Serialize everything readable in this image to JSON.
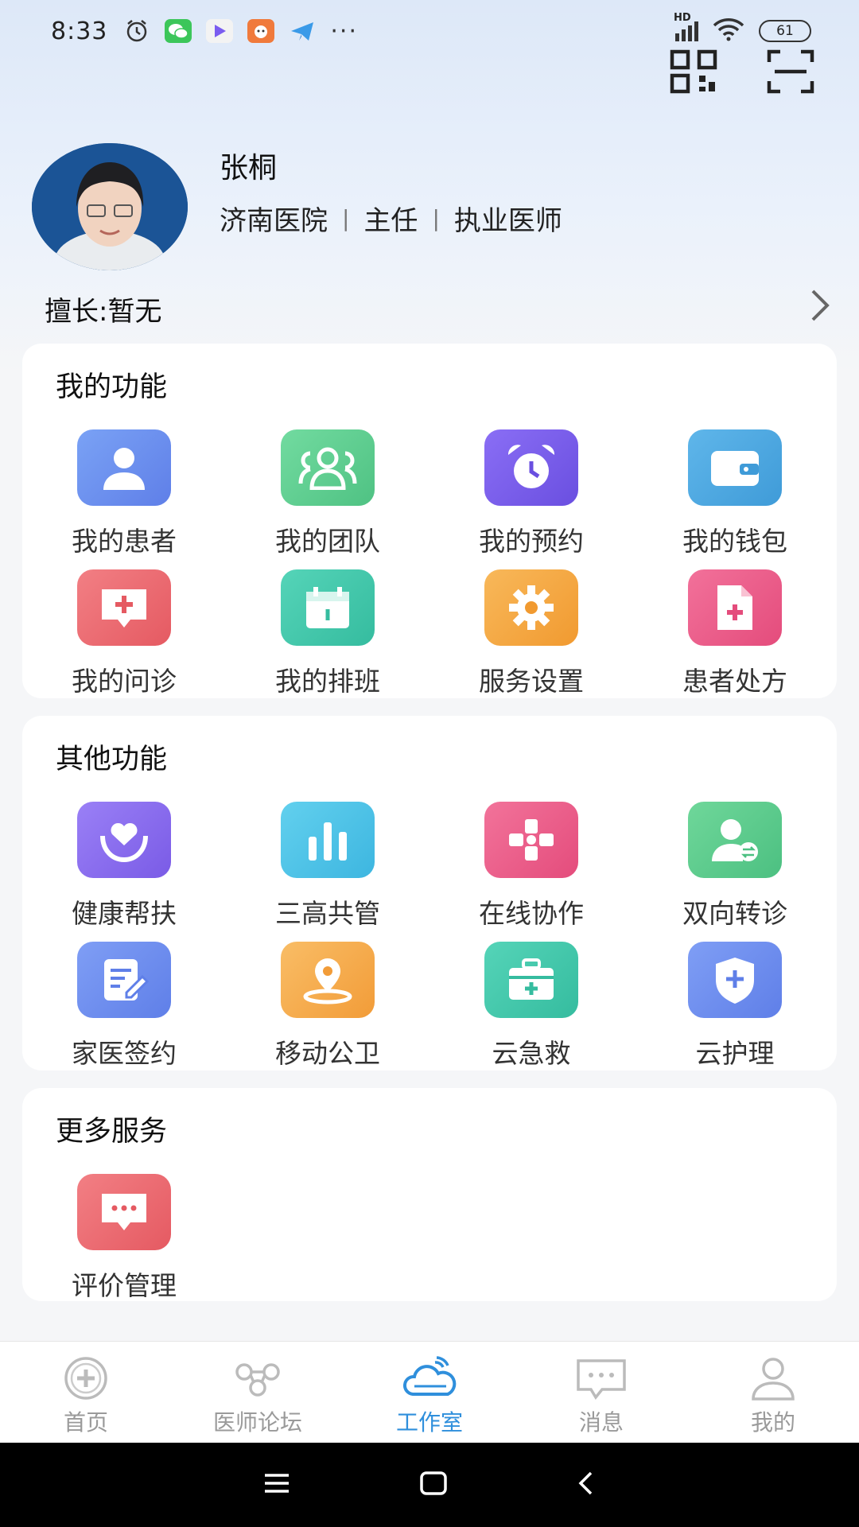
{
  "status_bar": {
    "time": "8:33",
    "battery": "61",
    "network_label": "HD"
  },
  "header": {
    "qr_icon": "qr-code-icon",
    "scan_icon": "scan-icon"
  },
  "profile": {
    "name": "张桐",
    "hospital": "济南医院",
    "title": "主任",
    "role": "执业医师",
    "specialty": "擅长:暂无"
  },
  "sections": {
    "my_functions": {
      "title": "我的功能",
      "items": [
        {
          "label": "我的患者",
          "icon": "patient-icon",
          "color": "#6f8ef0"
        },
        {
          "label": "我的团队",
          "icon": "team-icon",
          "color": "#5ccc8e"
        },
        {
          "label": "我的预约",
          "icon": "alarm-clock-icon",
          "color": "#7b5be8"
        },
        {
          "label": "我的钱包",
          "icon": "wallet-icon",
          "color": "#4aa8e0"
        },
        {
          "label": "我的问诊",
          "icon": "consult-icon",
          "color": "#ee6b72"
        },
        {
          "label": "我的排班",
          "icon": "calendar-icon",
          "color": "#3fc7ad"
        },
        {
          "label": "服务设置",
          "icon": "gear-icon",
          "color": "#f5a640"
        },
        {
          "label": "患者处方",
          "icon": "prescription-icon",
          "color": "#ee5c8a"
        }
      ]
    },
    "other_functions": {
      "title": "其他功能",
      "items": [
        {
          "label": "健康帮扶",
          "icon": "heart-hands-icon",
          "color": "#8a6ef0"
        },
        {
          "label": "三高共管",
          "icon": "bar-chart-icon",
          "color": "#4fc3e6"
        },
        {
          "label": "在线协作",
          "icon": "collaborate-icon",
          "color": "#ee5c82"
        },
        {
          "label": "双向转诊",
          "icon": "referral-icon",
          "color": "#5ccc8e"
        },
        {
          "label": "家医签约",
          "icon": "sign-contract-icon",
          "color": "#6f8ef0"
        },
        {
          "label": "移动公卫",
          "icon": "location-pin-icon",
          "color": "#f5a640"
        },
        {
          "label": "云急救",
          "icon": "first-aid-kit-icon",
          "color": "#3fc7ad"
        },
        {
          "label": "云护理",
          "icon": "shield-plus-icon",
          "color": "#6f8ef0"
        }
      ]
    },
    "more_services": {
      "title": "更多服务",
      "items": [
        {
          "label": "评价管理",
          "icon": "chat-bubble-icon",
          "color": "#ee6b72"
        }
      ]
    }
  },
  "tab_bar": {
    "tabs": [
      {
        "label": "首页",
        "icon": "home-cross-icon"
      },
      {
        "label": "医师论坛",
        "icon": "forum-icon"
      },
      {
        "label": "工作室",
        "icon": "cloud-icon"
      },
      {
        "label": "消息",
        "icon": "message-icon"
      },
      {
        "label": "我的",
        "icon": "user-icon"
      }
    ],
    "active_color": "#2f8fdc",
    "inactive_color": "#9a9a9a"
  }
}
